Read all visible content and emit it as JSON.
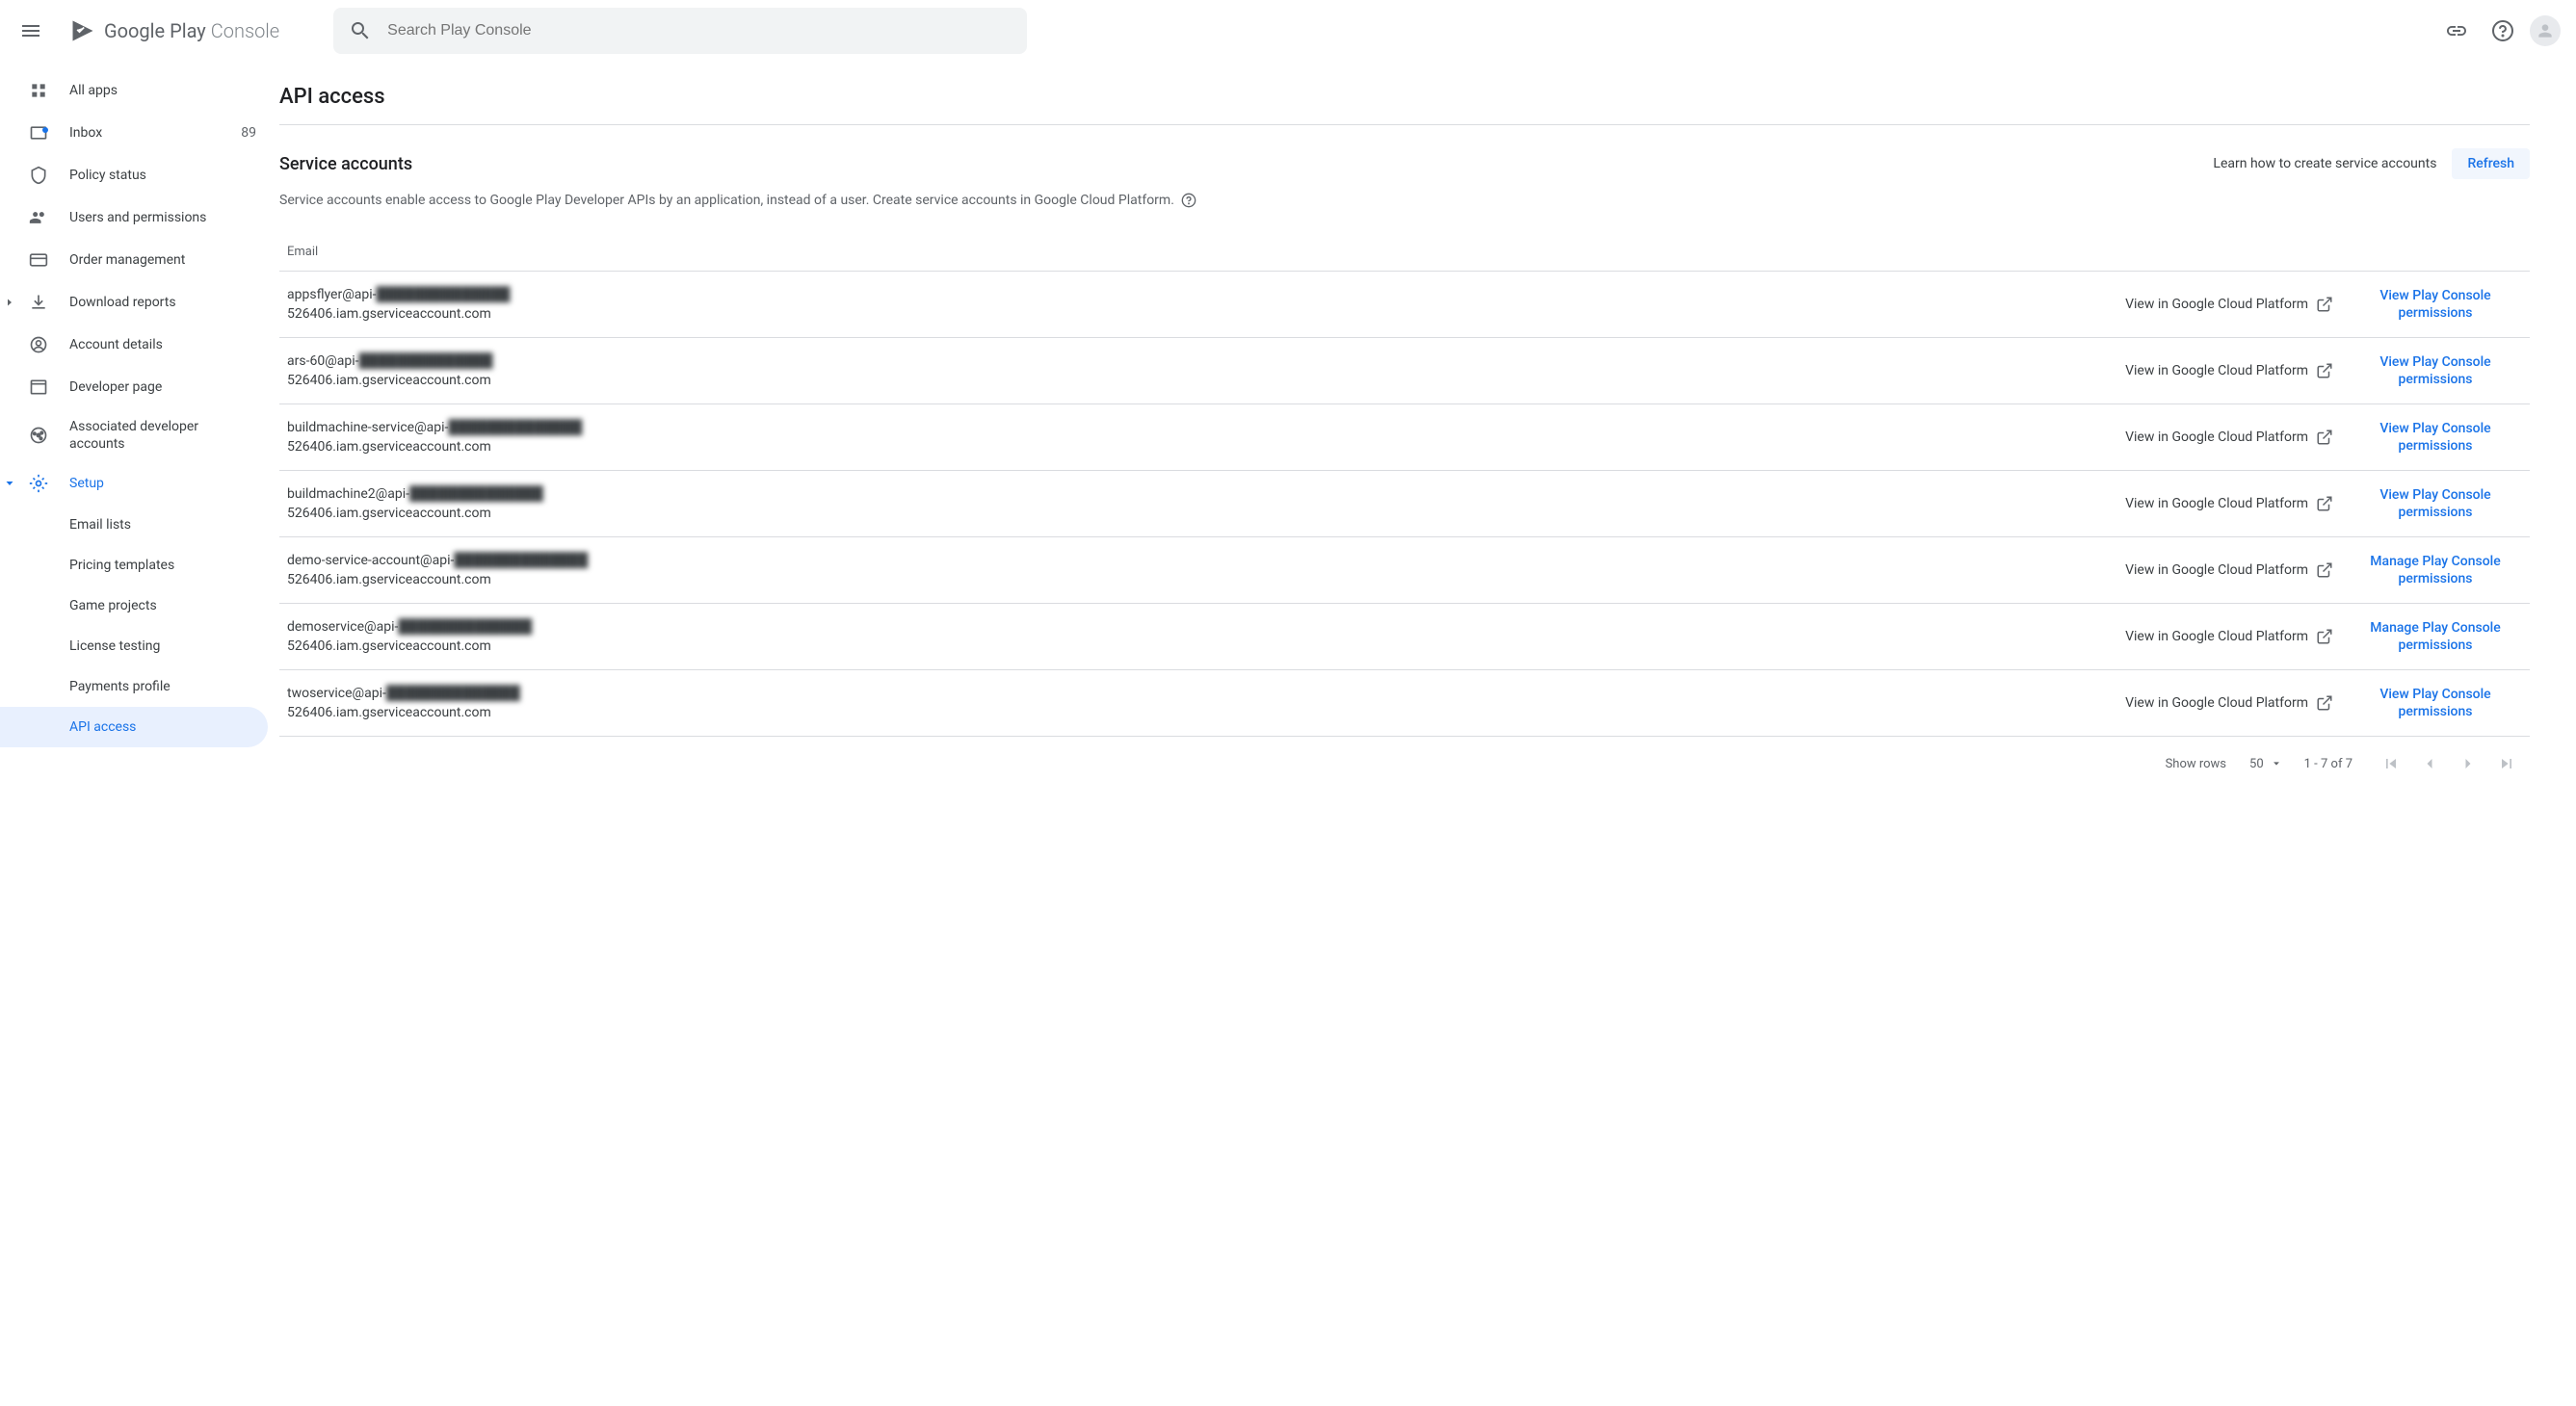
{
  "header": {
    "logo_text_main": "Google Play",
    "logo_text_sub": "Console",
    "search_placeholder": "Search Play Console"
  },
  "sidebar": {
    "all_apps": "All apps",
    "inbox": "Inbox",
    "inbox_count": "89",
    "policy_status": "Policy status",
    "users_permissions": "Users and permissions",
    "order_management": "Order management",
    "download_reports": "Download reports",
    "account_details": "Account details",
    "developer_page": "Developer page",
    "associated_accounts": "Associated developer accounts",
    "setup": "Setup",
    "email_lists": "Email lists",
    "pricing_templates": "Pricing templates",
    "game_projects": "Game projects",
    "license_testing": "License testing",
    "payments_profile": "Payments profile",
    "api_access": "API access"
  },
  "main": {
    "page_title": "API access",
    "section_title": "Service accounts",
    "learn_link": "Learn how to create service accounts",
    "refresh": "Refresh",
    "description": "Service accounts enable access to Google Play Developer APIs by an application, instead of a user. Create service accounts in Google Cloud Platform.",
    "col_email": "Email",
    "gcp_link": "View in Google Cloud Platform",
    "view_perms": "View Play Console permissions",
    "manage_perms": "Manage Play Console permissions",
    "rows": [
      {
        "line1_prefix": "appsflyer@api-",
        "line1_blur": "██████████████",
        "line2": "526406.iam.gserviceaccount.com",
        "action": "view"
      },
      {
        "line1_prefix": "ars-60@api-",
        "line1_blur": "██████████████",
        "line2": "526406.iam.gserviceaccount.com",
        "action": "view"
      },
      {
        "line1_prefix": "buildmachine-service@api-",
        "line1_blur": "██████████████",
        "line2": "526406.iam.gserviceaccount.com",
        "action": "view"
      },
      {
        "line1_prefix": "buildmachine2@api-",
        "line1_blur": "██████████████",
        "line2": "526406.iam.gserviceaccount.com",
        "action": "view"
      },
      {
        "line1_prefix": "demo-service-account@api-",
        "line1_blur": "██████████████",
        "line2": "526406.iam.gserviceaccount.com",
        "action": "manage"
      },
      {
        "line1_prefix": "demoservice@api-",
        "line1_blur": "██████████████",
        "line2": "526406.iam.gserviceaccount.com",
        "action": "manage"
      },
      {
        "line1_prefix": "twoservice@api-",
        "line1_blur": "██████████████",
        "line2": "526406.iam.gserviceaccount.com",
        "action": "view"
      }
    ],
    "show_rows_label": "Show rows",
    "rows_value": "50",
    "page_info": "1 - 7 of 7"
  }
}
